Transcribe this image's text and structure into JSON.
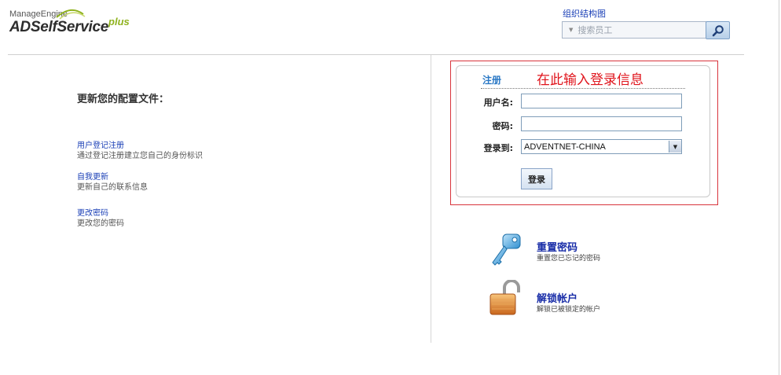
{
  "logo": {
    "top_text": "ManageEngine",
    "main_text": "ADSelfService",
    "suffix": "plus"
  },
  "header": {
    "org_chart_link": "组织结构图",
    "search_placeholder": "搜索员工"
  },
  "profile": {
    "title": "更新您的配置文件：",
    "links": [
      {
        "label": "用户登记注册",
        "desc": "通过登记注册建立您自己的身份标识"
      },
      {
        "label": "自我更新",
        "desc": "更新自己的联系信息"
      },
      {
        "label": "更改密码",
        "desc": "更改您的密码"
      }
    ]
  },
  "login": {
    "tab": "注册",
    "annotation": "在此输入登录信息",
    "username_label": "用户名:",
    "username_value": "",
    "password_label": "密码:",
    "password_value": "",
    "domain_label": "登录到:",
    "domain_value": "ADVENTNET-CHINA",
    "submit": "登录"
  },
  "features": [
    {
      "title": "重置密码",
      "desc": "重置您已忘记的密码",
      "icon": "key-icon"
    },
    {
      "title": "解锁帐户",
      "desc": "解锁已被锁定的帐户",
      "icon": "padlock-icon"
    }
  ],
  "colors": {
    "link": "#1a3fb6",
    "annotation": "#e0141c",
    "frame": "#d8343c",
    "tab": "#2a78c5",
    "feature_title": "#1a2ea8"
  }
}
